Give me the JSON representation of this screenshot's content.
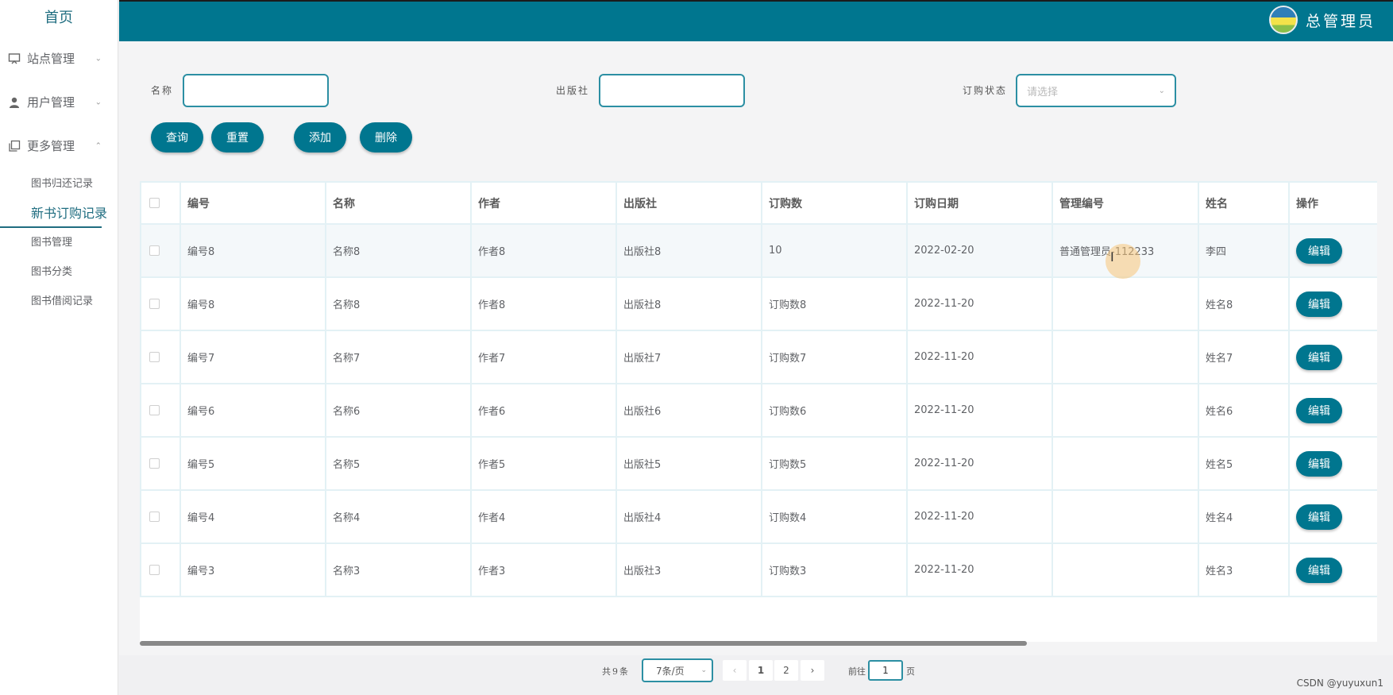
{
  "sidebar": {
    "home": "首页",
    "menu": [
      {
        "label": "站点管理",
        "icon": "monitor-icon"
      },
      {
        "label": "用户管理",
        "icon": "user-icon"
      },
      {
        "label": "更多管理",
        "icon": "copy-icon"
      }
    ],
    "submenu": [
      "图书归还记录",
      "新书订购记录",
      "图书管理",
      "图书分类",
      "图书借阅记录"
    ],
    "active_submenu": "新书订购记录"
  },
  "header": {
    "admin_name": "总管理员"
  },
  "search": {
    "name_label": "名称",
    "publisher_label": "出版社",
    "status_label": "订购状态",
    "status_placeholder": "请选择"
  },
  "buttons": {
    "query": "查询",
    "reset": "重置",
    "add": "添加",
    "delete": "删除"
  },
  "table": {
    "columns": [
      "编号",
      "名称",
      "作者",
      "出版社",
      "订购数",
      "订购日期",
      "管理编号",
      "姓名",
      "操作"
    ],
    "edit_label": "编辑",
    "rows": [
      [
        "编号8",
        "名称8",
        "作者8",
        "出版社8",
        "10",
        "2022-02-20",
        "普通管理员-112233",
        "李四"
      ],
      [
        "编号8",
        "名称8",
        "作者8",
        "出版社8",
        "订购数8",
        "2022-11-20",
        "",
        "姓名8"
      ],
      [
        "编号7",
        "名称7",
        "作者7",
        "出版社7",
        "订购数7",
        "2022-11-20",
        "",
        "姓名7"
      ],
      [
        "编号6",
        "名称6",
        "作者6",
        "出版社6",
        "订购数6",
        "2022-11-20",
        "",
        "姓名6"
      ],
      [
        "编号5",
        "名称5",
        "作者5",
        "出版社5",
        "订购数5",
        "2022-11-20",
        "",
        "姓名5"
      ],
      [
        "编号4",
        "名称4",
        "作者4",
        "出版社4",
        "订购数4",
        "2022-11-20",
        "",
        "姓名4"
      ],
      [
        "编号3",
        "名称3",
        "作者3",
        "出版社3",
        "订购数3",
        "2022-11-20",
        "",
        "姓名3"
      ]
    ]
  },
  "pagination": {
    "total": "共9条",
    "page_size": "7条/页",
    "pages": [
      "1",
      "2"
    ],
    "prev": "‹",
    "next": "›",
    "goto_label": "前往",
    "goto_value": "1",
    "page_unit": "页"
  },
  "watermark": "CSDN @yuyuxun1",
  "colors": {
    "primary": "#00768f",
    "accent_text": "#1f6d80"
  }
}
